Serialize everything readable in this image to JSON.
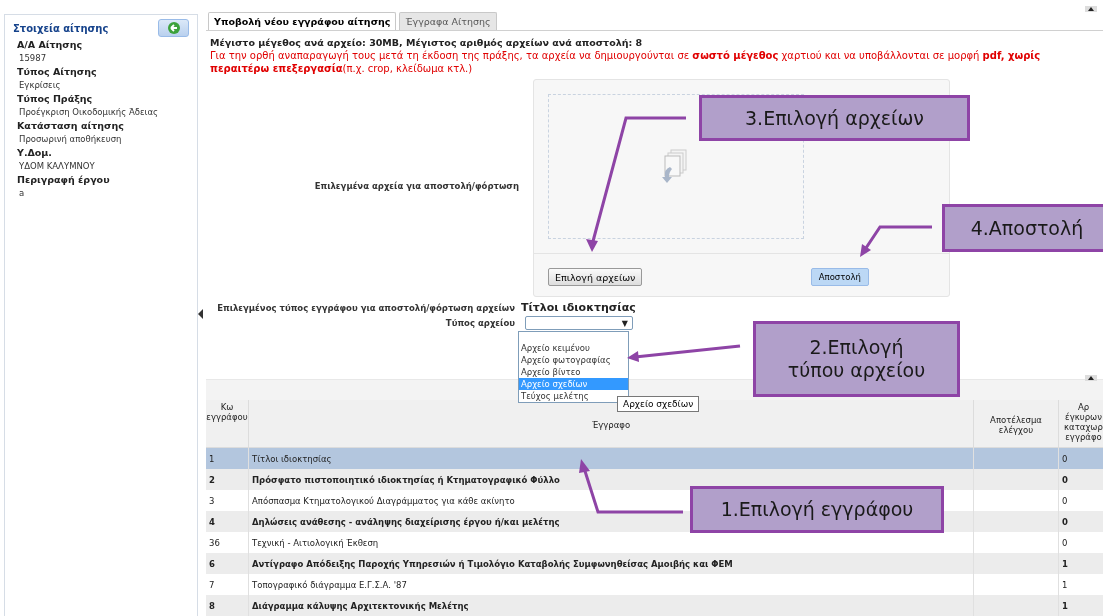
{
  "sidebar": {
    "title": "Στοιχεία αίτησης",
    "fields": [
      {
        "label": "Α/Α Αίτησης",
        "value": "15987"
      },
      {
        "label": "Τύπος Αίτησης",
        "value": "Εγκρίσεις"
      },
      {
        "label": "Τύπος Πράξης",
        "value": "Προέγκριση Οικοδομικής Άδειας"
      },
      {
        "label": "Κατάσταση αίτησης",
        "value": "Προσωρινή αποθήκευση"
      },
      {
        "label": "Υ.Δομ.",
        "value": "ΥΔΟΜ ΚΑΛΥΜΝΟΥ"
      },
      {
        "label": "Περιγραφή έργου",
        "value": "a"
      }
    ]
  },
  "tabs": [
    {
      "label": "Υποβολή νέου εγγράφου αίτησης",
      "selected": true
    },
    {
      "label": "Έγγραφα Αίτησης",
      "selected": false
    }
  ],
  "limits": "Μέγιστο μέγεθος ανά αρχείο: 30MB, Μέγιστος αριθμός αρχείων ανά αποστολή: 8",
  "warning": "Για την ορθή αναπαραγωγή τους μετά τη έκδοση της πράξης, τα αρχεία να δημιουργούνται σε **σωστό μέγεθος** χαρτιού και να υποβάλλονται σε μορφή **pdf, χωρίς περαιτέρω επεξεργασία**(π.χ. crop, κλείδωμα κτλ.)",
  "upload": {
    "label": "Επιλεγμένα αρχεία για αποστολή/φόρτωση",
    "choose_button": "Επιλογή αρχείων",
    "send_button": "Αποστολή"
  },
  "doc_type": {
    "label": "Επιλεγμένος τύπος εγγράφου για αποστολή/φόρτωση αρχείων",
    "value": "Τίτλοι ιδιοκτησίας"
  },
  "file_type": {
    "label": "Τύπος αρχείου",
    "arrow": "▼",
    "options": [
      {
        "label": "Αρχείο κειμένου",
        "selected": false
      },
      {
        "label": "Αρχείο φωτογραφίας",
        "selected": false
      },
      {
        "label": "Αρχείο βίντεο",
        "selected": false
      },
      {
        "label": "Αρχείο σχεδίων",
        "selected": true
      },
      {
        "label": "Τεύχος μελέτης",
        "selected": false
      }
    ],
    "tooltip": "Αρχείο σχεδίων"
  },
  "table": {
    "columns": [
      {
        "lines": [
          "Κω",
          "εγγράφου"
        ]
      },
      {
        "lines": [
          "Έγγραφο"
        ]
      },
      {
        "lines": [
          "Αποτέλεσμα",
          "ελέγχου"
        ]
      },
      {
        "lines": [
          "Αρ",
          "έγκυρων",
          "καταχωρ",
          "εγγράφο"
        ]
      }
    ],
    "rows": [
      {
        "cells": [
          "1",
          "Τίτλοι ιδιοκτησίας",
          "",
          "0"
        ],
        "selected": true
      },
      {
        "cells": [
          "2",
          "Πρόσφατο πιστοποιητικό ιδιοκτησίας ή Κτηματογραφικό Φύλλο",
          "",
          "0"
        ],
        "selected": false
      },
      {
        "cells": [
          "3",
          "Απόσπασμα Κτηματολογικού Διαγράμματος για κάθε ακίνητο",
          "",
          "0"
        ],
        "selected": false
      },
      {
        "cells": [
          "4",
          "Δηλώσεις ανάθεσης - ανάληψης διαχείρισης έργου ή/και μελέτης",
          "",
          "0"
        ],
        "selected": false
      },
      {
        "cells": [
          "36",
          "Τεχνική - Αιτιολογική Έκθεση",
          "",
          "0"
        ],
        "selected": false
      },
      {
        "cells": [
          "6",
          "Αντίγραφο Απόδειξης Παροχής Υπηρεσιών ή Τιμολόγιο Καταβολής Συμφωνηθείσας Αμοιβής και ΦΕΜ",
          "",
          "1"
        ],
        "selected": false
      },
      {
        "cells": [
          "7",
          "Τοπογραφικό διάγραμμα Ε.Γ.Σ.Α. '87",
          "",
          "1"
        ],
        "selected": false
      },
      {
        "cells": [
          "8",
          "Διάγραμμα κάλυψης Αρχιτεκτονικής Μελέτης",
          "",
          "1"
        ],
        "selected": false
      }
    ]
  },
  "callouts": [
    "3.Επιλογή αρχείων",
    "4.Αποστολή",
    "2.Επιλογή τύπου αρχείου",
    "1.Επιλογή εγγράφου"
  ]
}
